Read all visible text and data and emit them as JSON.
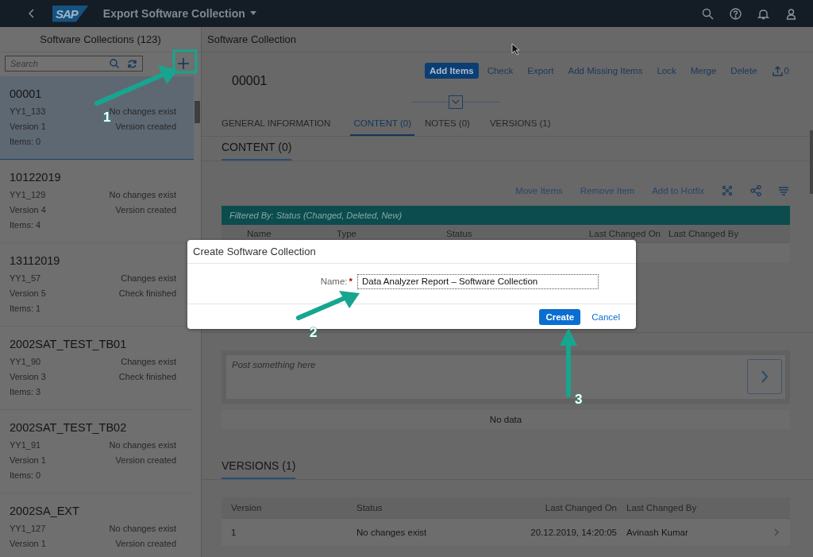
{
  "shell": {
    "title": "Export Software Collection",
    "logo": "SAP"
  },
  "master": {
    "title": "Software Collections (123)",
    "search": {
      "placeholder": "Search"
    },
    "items": [
      {
        "name": "00001",
        "code": "YY1_133",
        "status": "No changes exist",
        "version": "Version 1",
        "state": "Version created",
        "count": "Items: 0",
        "selected": true
      },
      {
        "name": "10122019",
        "code": "YY1_129",
        "status": "No changes exist",
        "version": "Version 4",
        "state": "Version created",
        "count": "Items: 4",
        "selected": false
      },
      {
        "name": "13112019",
        "code": "YY1_57",
        "status": "Changes exist",
        "version": "Version 5",
        "state": "Check finished",
        "count": "Items: 1",
        "selected": false
      },
      {
        "name": "2002SAT_TEST_TB01",
        "code": "YY1_90",
        "status": "Changes exist",
        "version": "Version 3",
        "state": "Check finished",
        "count": "Items: 3",
        "selected": false
      },
      {
        "name": "2002SAT_TEST_TB02",
        "code": "YY1_91",
        "status": "No changes exist",
        "version": "Version 1",
        "state": "Version created",
        "count": "Items: 0",
        "selected": false
      },
      {
        "name": "2002SA_EXT",
        "code": "YY1_127",
        "status": "No changes exist",
        "version": "Version 1",
        "state": "Version created",
        "selected": false
      }
    ]
  },
  "detail": {
    "title": "Software Collection",
    "object_title": "00001",
    "actions": [
      {
        "label": "Add Items",
        "kind": "primary"
      },
      {
        "label": "Check",
        "kind": "link"
      },
      {
        "label": "Export",
        "kind": "link"
      },
      {
        "label": "Add Missing Items",
        "kind": "link"
      },
      {
        "label": "Lock",
        "kind": "link"
      },
      {
        "label": "Merge",
        "kind": "link"
      },
      {
        "label": "Delete",
        "kind": "link"
      }
    ],
    "upload_count": "0",
    "tabs": [
      {
        "label": "GENERAL INFORMATION",
        "selected": false
      },
      {
        "label": "CONTENT (0)",
        "selected": true
      },
      {
        "label": "NOTES (0)",
        "selected": false
      },
      {
        "label": "VERSIONS (1)",
        "selected": false
      }
    ],
    "content": {
      "title": "CONTENT (0)",
      "toolbar": [
        "Move Items",
        "Remove Item",
        "Add to Hotfix"
      ],
      "filter": "Filtered By: Status (Changed, Deleted, New)",
      "columns": [
        "Name",
        "Type",
        "Status",
        "Last Changed On",
        "Last Changed By"
      ]
    },
    "feed": {
      "placeholder": "Post something here"
    },
    "no_data": "No data",
    "versions": {
      "title": "VERSIONS (1)",
      "columns": [
        "Version",
        "Status",
        "Last Changed On",
        "Last Changed By"
      ],
      "rows": [
        [
          "1",
          "No changes exist",
          "20.12.2019, 14:20:05",
          "Avinash Kumar"
        ]
      ]
    }
  },
  "dialog": {
    "title": "Create Software Collection",
    "field": {
      "label": "Name:",
      "required": true,
      "required_mark": "*",
      "value": "Data Analyzer Report – Software Collection"
    },
    "buttons": [
      {
        "label": "Create",
        "kind": "primary"
      },
      {
        "label": "Cancel",
        "kind": "link"
      }
    ]
  },
  "annotations": [
    {
      "label": "1"
    },
    {
      "label": "2"
    },
    {
      "label": "3"
    }
  ]
}
